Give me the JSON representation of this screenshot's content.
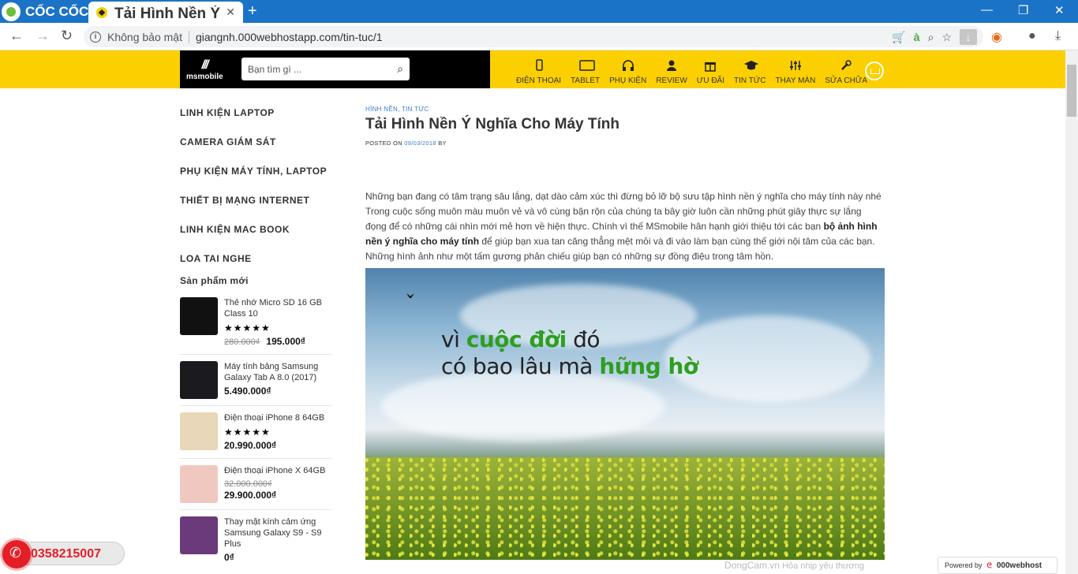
{
  "browser": {
    "brand": "CỐC CỐC",
    "tab_title": "Tải Hình Nền Ý Nghĩa Ch",
    "new_tab": "+",
    "insecure_label": "Không bảo mật",
    "url": "giangnh.000webhostapp.com/tin-tuc/1"
  },
  "header": {
    "logo_text": "msmobile",
    "search_placeholder": "Bạn tìm gì ...",
    "nav": [
      {
        "label": "ĐIỆN THOẠI",
        "icon": "phone-icon"
      },
      {
        "label": "TABLET",
        "icon": "tablet-icon"
      },
      {
        "label": "PHỤ KIỆN",
        "icon": "headphones-icon"
      },
      {
        "label": "REVIEW",
        "icon": "user-icon"
      },
      {
        "label": "ƯU ĐÃI",
        "icon": "gift-icon"
      },
      {
        "label": "TIN TỨC",
        "icon": "graduation-cap-icon"
      },
      {
        "label": "THAY MÀN",
        "icon": "sliders-icon"
      },
      {
        "label": "SỬA CHỮA",
        "icon": "wrench-icon"
      }
    ]
  },
  "sidebar": {
    "categories": [
      "LINH KIỆN LAPTOP",
      "CAMERA GIÁM SÁT",
      "PHỤ KIỆN MÁY TÍNH, LAPTOP",
      "THIẾT BỊ MẠNG INTERNET",
      "LINH KIỆN MAC BOOK",
      "LOA TAI NGHE"
    ],
    "new_products_title": "Sản phẩm mới",
    "products": [
      {
        "name": "Thẻ nhớ Micro SD 16 GB Class 10",
        "stars": "★★★★★",
        "old_price": "280.000₫",
        "price": "195.000₫",
        "thumb_color": "#111111"
      },
      {
        "name": "Máy tính bảng Samsung Galaxy Tab A 8.0 (2017)",
        "stars": "",
        "old_price": "",
        "price": "5.490.000₫",
        "thumb_color": "#1b1b1f"
      },
      {
        "name": "Điện thoại iPhone 8 64GB",
        "stars": "★★★★★",
        "old_price": "",
        "price": "20.990.000₫",
        "thumb_color": "#e8d7b8"
      },
      {
        "name": "Điện thoại iPhone X 64GB",
        "stars": "",
        "old_price": "32.000.000₫",
        "price": "29.900.000₫",
        "thumb_color": "#f0c8c0"
      },
      {
        "name": "Thay mặt kính cảm ứng Samsung Galaxy S9 - S9 Plus",
        "stars": "",
        "old_price": "",
        "price": "0₫",
        "thumb_color": "#6b3a7a"
      }
    ]
  },
  "article": {
    "categories": "HÌNH NỀN, TIN TỨC",
    "title": "Tải Hình Nền Ý Nghĩa Cho Máy Tính",
    "posted_on": "POSTED ON",
    "date": "09/03/2018",
    "by": "BY",
    "para_1": "Những bạn đang có tâm trạng sâu lắng, dạt dào cảm xúc thì đừng bỏ lỡ bộ sưu tập hình nền ý nghĩa cho máy tính này nhé Trong cuộc sống muôn màu muôn vẻ và vô cùng bận rộn của chúng ta bây giờ luôn cần những phút giây thực sự lắng đọng để có những cái nhìn mới mẻ hơn về hiện thực. Chính vì thế MSmobile hân hạnh giới thiệu tới các bạn",
    "bold_text": "bộ ảnh hình nền ý nghĩa cho máy tính",
    "para_2": "để giúp bạn xua tan căng thẳng mệt mỏi và đi vào làm bạn cùng thế giới nội tâm của các bạn. Những hình ảnh như một tấm gương phản chiếu giúp bạn có những sự đồng điệu trong tâm hồn.",
    "hero_line1_a": "vì ",
    "hero_line1_b": "cuộc đời",
    "hero_line1_c": " đó",
    "hero_line2_a": "có bao lâu mà ",
    "hero_line2_b": "hững hờ",
    "watermark_site": "DongCam.vn",
    "watermark_text": "Hỏa nhịp yêu thương"
  },
  "floating": {
    "hotline": "0358215007",
    "powered_by": "Powered by",
    "host": "000webhost"
  },
  "colors": {
    "header_bg": "#fcd000",
    "tabbar_bg": "#1a73c7",
    "hotline_red": "#e41e26",
    "accent_blue": "#3a7ec8"
  }
}
